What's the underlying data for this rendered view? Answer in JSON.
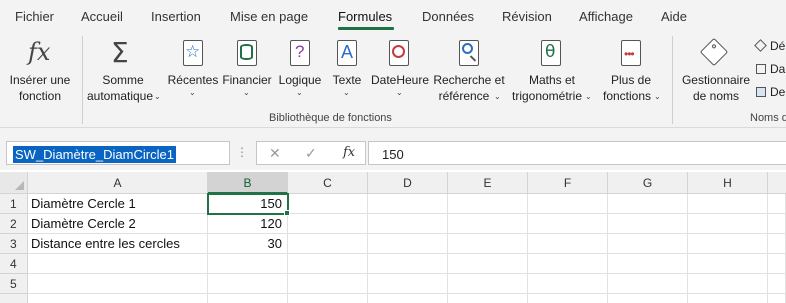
{
  "menu": {
    "tabs": [
      "Fichier",
      "Accueil",
      "Insertion",
      "Mise en page",
      "Formules",
      "Données",
      "Révision",
      "Affichage",
      "Aide"
    ],
    "active": "Formules"
  },
  "ribbon": {
    "insert_function": [
      "Insérer une",
      "fonction"
    ],
    "autosum": [
      "Somme",
      "automatique"
    ],
    "recent": "Récentes",
    "financial": "Financier",
    "logical": "Logique",
    "text": "Texte",
    "datetime": "DateHeure",
    "lookup": [
      "Recherche et",
      "référence"
    ],
    "math": [
      "Maths et",
      "trigonométrie"
    ],
    "more": [
      "Plus de",
      "fonctions"
    ],
    "name_manager": [
      "Gestionnaire",
      "de noms"
    ],
    "group_function_library": "Bibliothèque de fonctions",
    "group_names": "Noms d",
    "small_cmds": [
      "Dé",
      "Da",
      "De"
    ],
    "icons": {
      "insert_function": "fx-icon",
      "autosum": "sigma-icon",
      "recent": "star-book-icon",
      "financial": "coins-book-icon",
      "logical": "question-book-icon",
      "text": "a-book-icon",
      "datetime": "clock-book-icon",
      "lookup": "magnifier-book-icon",
      "math": "theta-book-icon",
      "more": "more-book-icon",
      "name_manager": "tag-icon"
    },
    "colors": {
      "accent": "#217346",
      "recent": "#2b6fc2",
      "financial": "#1e7145",
      "logical": "#8a3ea5",
      "text": "#2b6fc2",
      "datetime": "#c43b3b",
      "lookup": "#2b6fc2",
      "math": "#1e7145",
      "more": "#c43b3b"
    }
  },
  "formula_bar": {
    "name_box": "SW_Diamètre_DiamCircle1",
    "cancel": "✕",
    "enter": "✓",
    "fx": "fx",
    "value": "150"
  },
  "grid": {
    "columns": [
      "A",
      "B",
      "C",
      "D",
      "E",
      "F",
      "G",
      "H"
    ],
    "selected_column": "B",
    "rows": [
      "1",
      "2",
      "3",
      "4",
      "5"
    ],
    "cells": [
      {
        "label": "Diamètre Cercle 1",
        "value": "150"
      },
      {
        "label": "Diamètre Cercle 2",
        "value": "120"
      },
      {
        "label": "Distance entre les cercles",
        "value": "30"
      }
    ]
  }
}
